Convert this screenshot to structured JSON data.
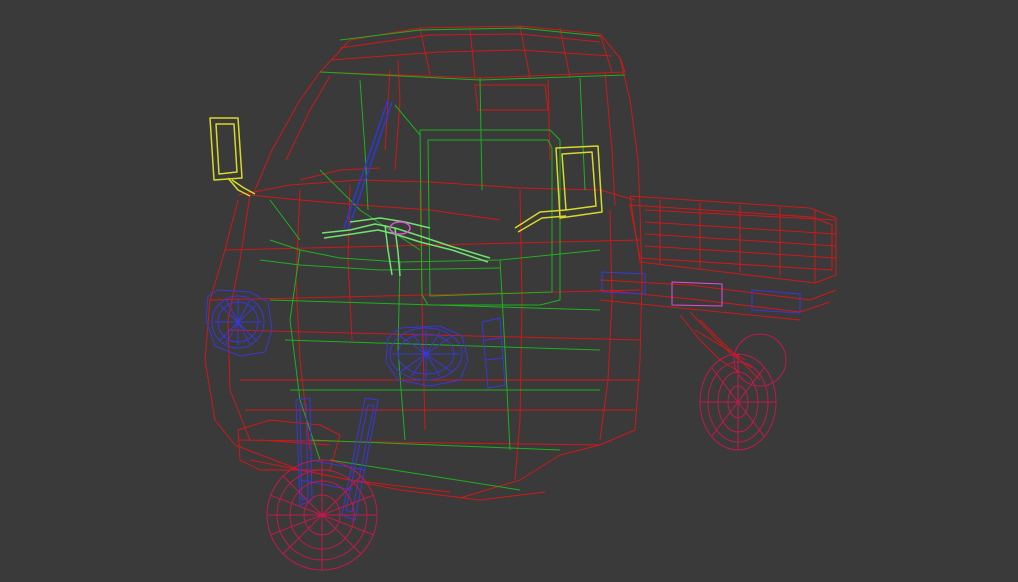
{
  "viewport": {
    "background": "#3a3a3a",
    "model": "three-wheeler-cargo-truck",
    "render_mode": "wireframe"
  },
  "colors": {
    "body": "#d01818",
    "frame": "#1fb01f",
    "mirror": "#d8d82a",
    "headlight": "#3838d8",
    "handlebar": "#6fe36f",
    "wheel": "#c01a4a",
    "accent": "#e050d0",
    "steering_column": "#2a3ad8"
  }
}
